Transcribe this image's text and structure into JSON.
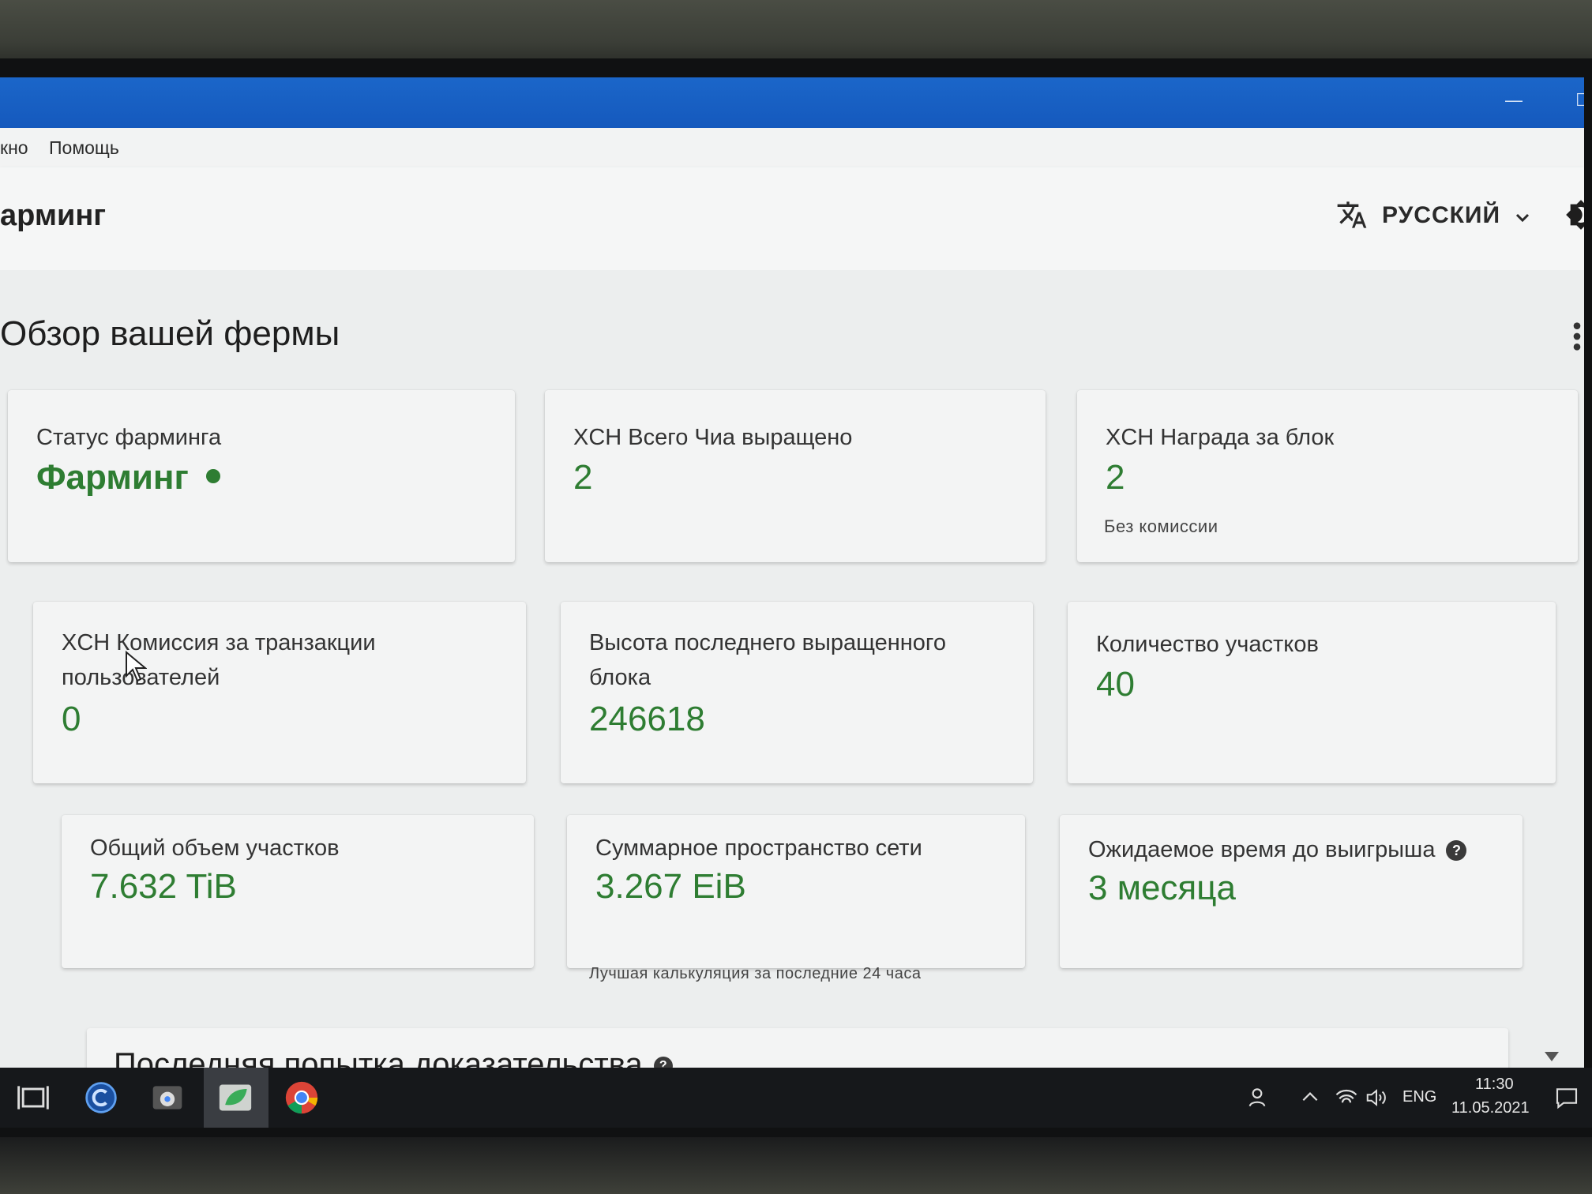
{
  "window": {
    "minimize_glyph": "—",
    "maximize_glyph": "☐"
  },
  "menu": {
    "window_label": "кно",
    "help_label": "Помощь"
  },
  "header": {
    "page_title": "арминг",
    "language_label": "РУССКИЙ",
    "icons": [
      "translate-icon",
      "chevron-down-icon",
      "theme-icon"
    ]
  },
  "overview": {
    "title": "Обзор вашей фермы",
    "cards": {
      "farming_status": {
        "title": "Статус фарминга",
        "value": "Фарминг",
        "status_color": "#2e7d32"
      },
      "total_chia": {
        "title": "XCH Всего Чиа выращено",
        "value": "2"
      },
      "block_reward": {
        "title": "XCH Награда за блок",
        "value": "2",
        "sub": "Без комиссии"
      },
      "user_fees": {
        "title_line1": "XCH Комиссия за транзакции",
        "title_line2": "пользователей",
        "value": "0"
      },
      "last_height": {
        "title_line1": "Высота последнего выращенного",
        "title_line2": "блока",
        "value": "246618"
      },
      "plot_count": {
        "title": "Количество участков",
        "value": "40"
      },
      "total_size": {
        "title": "Общий объем участков",
        "value": "7.632 TiB"
      },
      "netspace": {
        "title": "Суммарное пространство сети",
        "value": "3.267 EiB",
        "sub": "Лучшая калькуляция за последние 24 часа"
      },
      "time_to_win": {
        "title": "Ожидаемое время до выигрыша",
        "value": "3 месяца",
        "help_glyph": "?"
      }
    },
    "last_proof": {
      "title": "Последняя попытка доказательства",
      "help_glyph": "?"
    }
  },
  "taskbar": {
    "language": "ENG",
    "time": "11:30",
    "date": "11.05.2021",
    "apps": [
      "task-view-icon",
      "ccleaner-icon",
      "chrome-app-icon",
      "chia-icon",
      "chrome-icon"
    ]
  },
  "colors": {
    "titlebar": "#1559bd",
    "accent_green": "#2e7d32",
    "taskbar": "#16181b"
  }
}
